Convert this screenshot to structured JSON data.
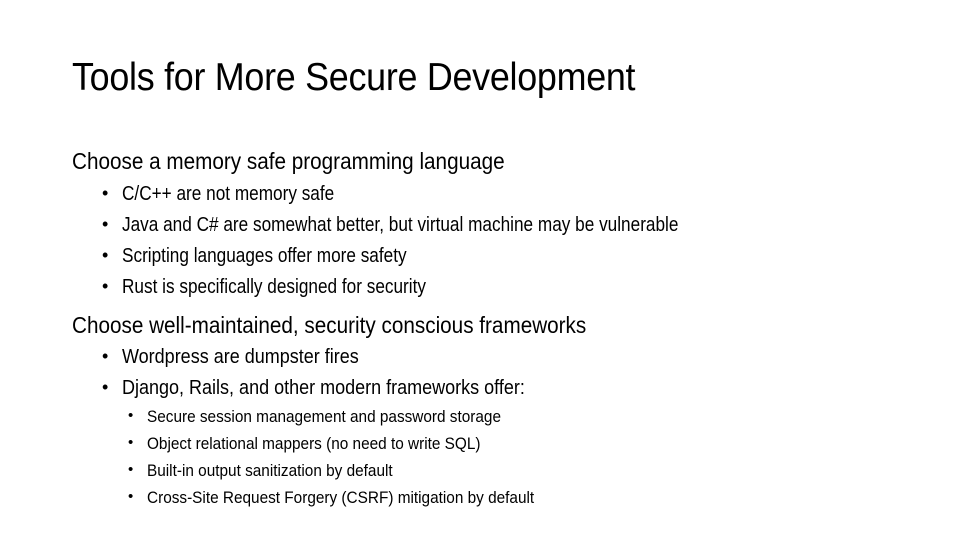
{
  "slide": {
    "title": "Tools for More Secure Development",
    "sections": [
      {
        "heading": "Choose a memory safe programming language",
        "bullets": [
          "C/C++ are not memory safe",
          "Java and C# are somewhat better, but virtual machine may be vulnerable",
          "Scripting languages offer more safety",
          "Rust is specifically designed for security"
        ]
      },
      {
        "heading": "Choose well-maintained, security conscious frameworks",
        "bullets": [
          {
            "text": "Wordpress are dumpster fires"
          },
          {
            "text": "Django, Rails, and other modern frameworks offer:",
            "sub_bullets": [
              "Secure session management and password storage",
              "Object relational mappers (no need to write SQL)",
              "Built-in output sanitization by default",
              "Cross-Site Request Forgery (CSRF) mitigation by default"
            ]
          }
        ]
      }
    ],
    "bullet_glyph": "•"
  }
}
